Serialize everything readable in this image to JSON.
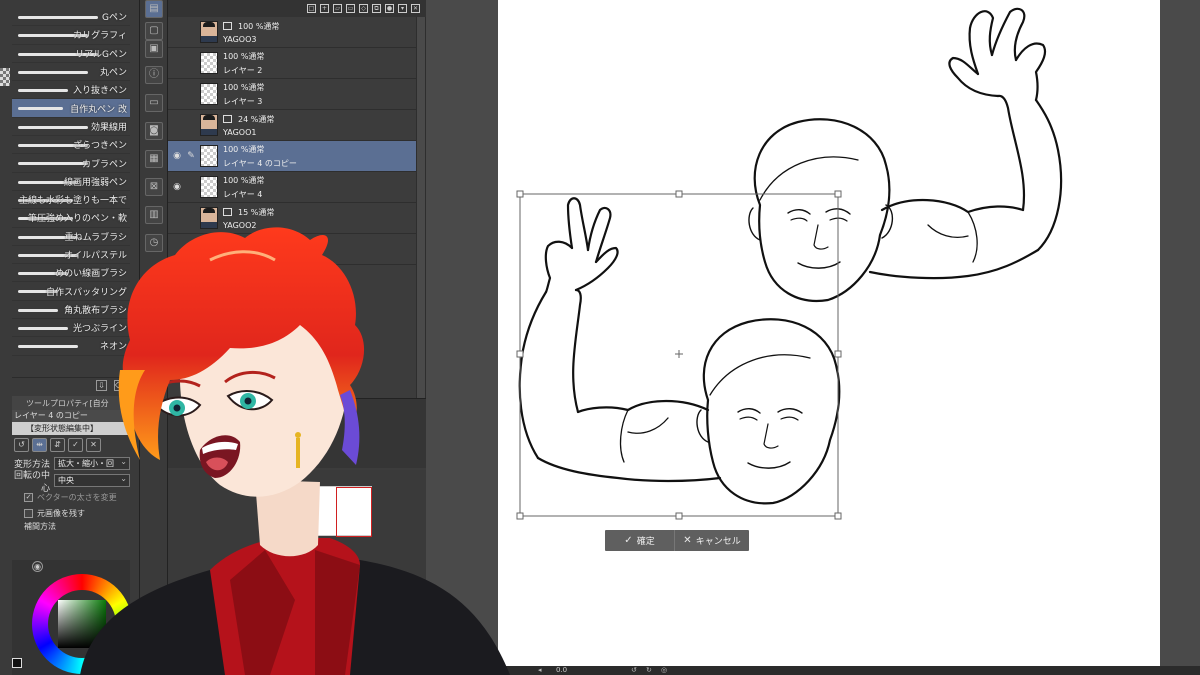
{
  "brushes": {
    "items": [
      {
        "label": "Gペン",
        "stroke": 80,
        "active": false
      },
      {
        "label": "カリグラフィ",
        "stroke": 70,
        "active": false
      },
      {
        "label": "リアルGペン",
        "stroke": 80,
        "active": false
      },
      {
        "label": "丸ペン",
        "stroke": 70,
        "active": false
      },
      {
        "label": "入り抜きペン",
        "stroke": 50,
        "active": false
      },
      {
        "label": "自作丸ペン 改",
        "stroke": 45,
        "active": true
      },
      {
        "label": "効果線用",
        "stroke": 70,
        "active": false
      },
      {
        "label": "ざらつきペン",
        "stroke": 70,
        "active": false
      },
      {
        "label": "カブラペン",
        "stroke": 70,
        "active": false
      },
      {
        "label": "線画用強弱ペン",
        "stroke": 60,
        "active": false
      },
      {
        "label": "主線も水彩も塗りも一本で",
        "stroke": 55,
        "active": false
      },
      {
        "label": "筆圧強め入りのペン・軟",
        "stroke": 55,
        "active": false
      },
      {
        "label": "重ねムラブラシ",
        "stroke": 60,
        "active": false
      },
      {
        "label": "オイルパステル",
        "stroke": 60,
        "active": false
      },
      {
        "label": "めのい線画ブラシ",
        "stroke": 50,
        "active": false
      },
      {
        "label": "自作スパッタリング",
        "stroke": 40,
        "active": false
      },
      {
        "label": "角丸散布ブラシ",
        "stroke": 40,
        "active": false
      },
      {
        "label": "光つぶライン",
        "stroke": 50,
        "active": false
      },
      {
        "label": "ネオン",
        "stroke": 60,
        "active": false
      }
    ]
  },
  "tool_property": {
    "tab_label": "ツールプロパティ[自分",
    "layer_name": "レイヤー 4 のコピー",
    "status": "【変形状態編集中】",
    "rows": [
      {
        "label": "変形方法",
        "value": "拡大・縮小・回"
      },
      {
        "label": "回転の中心",
        "value": "中央"
      }
    ],
    "checks": [
      {
        "label": "ベクターの太さを変更",
        "checked": true,
        "dim": true
      },
      {
        "label": "元画像を残す",
        "checked": false,
        "dim": false
      }
    ],
    "partial_label": "補間方法"
  },
  "layers": {
    "items": [
      {
        "opacity_mode": "100 %通常",
        "name": "YAGOO3",
        "thumb": "photo",
        "visible": false,
        "selected": false,
        "editing": false,
        "mode_icon": true
      },
      {
        "opacity_mode": "100 %通常",
        "name": "レイヤー 2",
        "thumb": "checker",
        "visible": false,
        "selected": false,
        "editing": false,
        "mode_icon": false
      },
      {
        "opacity_mode": "100 %通常",
        "name": "レイヤー 3",
        "thumb": "checker",
        "visible": false,
        "selected": false,
        "editing": false,
        "mode_icon": false
      },
      {
        "opacity_mode": "24 %通常",
        "name": "YAGOO1",
        "thumb": "photo",
        "visible": false,
        "selected": false,
        "editing": false,
        "mode_icon": true
      },
      {
        "opacity_mode": "100 %通常",
        "name": "レイヤー 4 のコピー",
        "thumb": "checker",
        "visible": true,
        "selected": true,
        "editing": true,
        "mode_icon": false
      },
      {
        "opacity_mode": "100 %通常",
        "name": "レイヤー 4",
        "thumb": "checker",
        "visible": true,
        "selected": false,
        "editing": false,
        "mode_icon": false
      },
      {
        "opacity_mode": "15 %通常",
        "name": "YAGOO2",
        "thumb": "photo",
        "visible": false,
        "selected": false,
        "editing": false,
        "mode_icon": true
      },
      {
        "opacity_mode": "100 %通常",
        "name": "",
        "thumb": "checker",
        "visible": false,
        "selected": false,
        "editing": false,
        "mode_icon": true
      }
    ]
  },
  "transform_toolbar": {
    "confirm_label": "確定",
    "cancel_label": "キャンセル"
  },
  "status_bar": {
    "zoom": "0.0"
  },
  "colors": {
    "selection": "#5b6f93",
    "panel": "#3a3a3a",
    "canvas_bg": "#4a4a4a",
    "hair_red": "#e0261c",
    "jacket": "#1b1b1f",
    "shirt_red": "#b5121b"
  }
}
